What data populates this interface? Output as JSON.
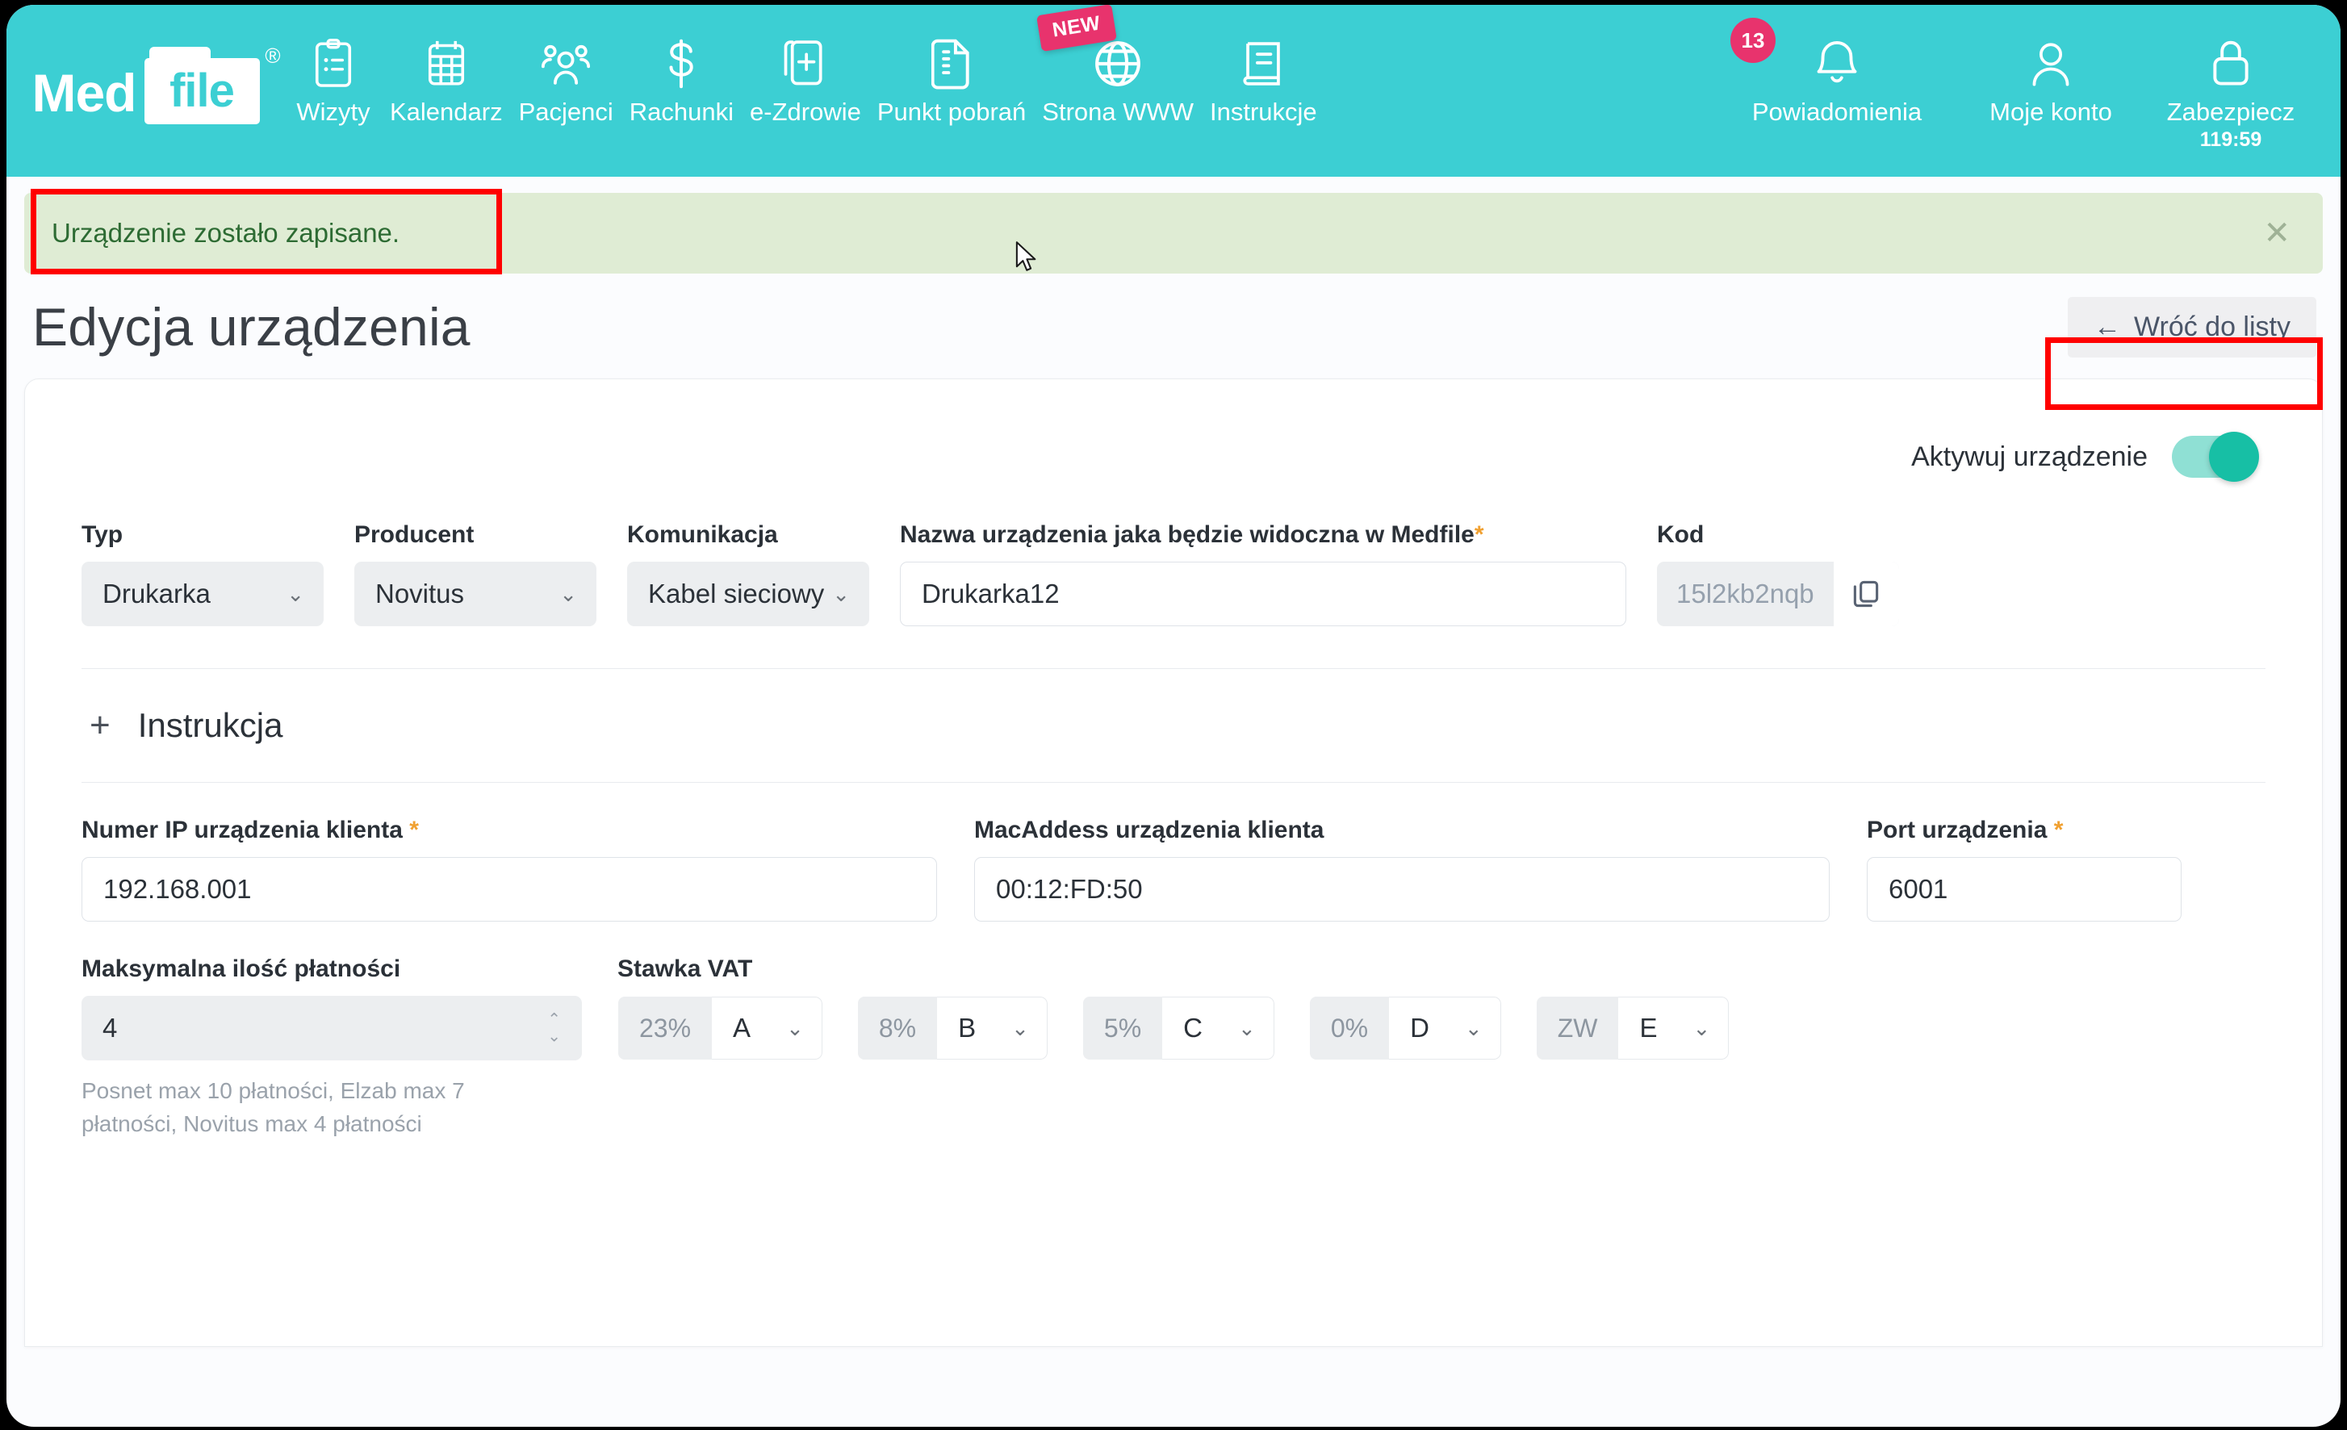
{
  "brand": {
    "med": "Med",
    "file": "file",
    "reg": "®"
  },
  "nav": {
    "items": [
      {
        "label": "Wizyty",
        "icon": "clipboard-icon"
      },
      {
        "label": "Kalendarz",
        "icon": "calendar-icon"
      },
      {
        "label": "Pacjenci",
        "icon": "people-icon"
      },
      {
        "label": "Rachunki",
        "icon": "dollar-icon"
      },
      {
        "label": "e-Zdrowie",
        "icon": "health-card-icon"
      },
      {
        "label": "Punkt pobrań",
        "icon": "document-icon"
      },
      {
        "label": "Strona WWW",
        "icon": "globe-icon",
        "badge": "NEW"
      },
      {
        "label": "Instrukcje",
        "icon": "book-icon"
      }
    ],
    "right_items": [
      {
        "label": "Powiadomienia",
        "icon": "bell-icon",
        "count": "13"
      },
      {
        "label": "Moje konto",
        "icon": "user-icon"
      },
      {
        "label": "Zabezpiecz",
        "icon": "lock-icon",
        "timer": "119:59"
      }
    ]
  },
  "alert": {
    "message": "Urządzenie zostało zapisane.",
    "close": "✕"
  },
  "page": {
    "title": "Edycja urządzenia",
    "back_label": "Wróć do listy",
    "back_icon": "←"
  },
  "form": {
    "activate_label": "Aktywuj urządzenie",
    "activate_state": "on",
    "typ": {
      "label": "Typ",
      "value": "Drukarka"
    },
    "producent": {
      "label": "Producent",
      "value": "Novitus"
    },
    "komunikacja": {
      "label": "Komunikacja",
      "value": "Kabel sieciowy / w"
    },
    "nazwa": {
      "label": "Nazwa urządzenia jaka będzie widoczna w Medfile",
      "required": "*",
      "value": "Drukarka12"
    },
    "kod": {
      "label": "Kod",
      "value": "15l2kb2nqb",
      "copy_icon": "copy-icon"
    },
    "instrukcja": {
      "plus": "+",
      "title": "Instrukcja"
    },
    "ip": {
      "label": "Numer IP urządzenia klienta",
      "required": "*",
      "value": "192.168.001"
    },
    "mac": {
      "label": "MacAddess urządzenia klienta",
      "value": "00:12:FD:50"
    },
    "port": {
      "label": "Port urządzenia",
      "required": "*",
      "value": "6001"
    },
    "maks": {
      "label": "Maksymalna ilość płatności",
      "value": "4",
      "hint": "Posnet max 10 płatności, Elzab max 7 płatności, Novitus max 4 płatności"
    },
    "vat": {
      "label": "Stawka VAT",
      "items": [
        {
          "pct": "23%",
          "letter": "A"
        },
        {
          "pct": "8%",
          "letter": "B"
        },
        {
          "pct": "5%",
          "letter": "C"
        },
        {
          "pct": "0%",
          "letter": "D"
        },
        {
          "pct": "ZW",
          "letter": "E"
        }
      ]
    }
  },
  "colors": {
    "brand_teal": "#3ccfd3",
    "accent_pink": "#e8336d",
    "toggle_on": "#17bfa5",
    "alert_bg": "#dfecd4",
    "alert_text": "#2d6b33",
    "annotation_red": "#ff0000",
    "required_orange": "#f0a030"
  }
}
